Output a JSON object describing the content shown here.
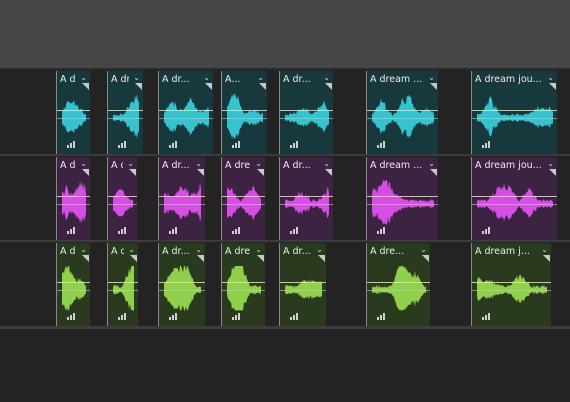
{
  "colors": {
    "topbar": "#464646",
    "track_bg": "#232323",
    "cyan_clip_bg": "#17393e",
    "cyan_wave": "#35c4cf",
    "purple_clip_bg": "#3c2342",
    "purple_wave": "#d64fe4",
    "green_clip_bg": "#2a3a1f",
    "green_wave": "#8fd14a"
  },
  "tracks": [
    {
      "name": "track-cyan",
      "clips": [
        {
          "title": "A dr..."
        },
        {
          "title": "A dr..."
        },
        {
          "title": "A dr..."
        },
        {
          "title": "A..."
        },
        {
          "title": "A dr..."
        },
        {
          "title": "A dream ..."
        },
        {
          "title": "A dream jou..."
        }
      ]
    },
    {
      "name": "track-purple",
      "clips": [
        {
          "title": "A dr..."
        },
        {
          "title": "A d..."
        },
        {
          "title": "A dr..."
        },
        {
          "title": "A dre..."
        },
        {
          "title": "A dr..."
        },
        {
          "title": "A dream ..."
        },
        {
          "title": "A dream jou..."
        }
      ]
    },
    {
      "name": "track-green",
      "clips": [
        {
          "title": "A dr..."
        },
        {
          "title": "A d..."
        },
        {
          "title": "A dr..."
        },
        {
          "title": "A dre..."
        },
        {
          "title": "A dr..."
        },
        {
          "title": "A dre..."
        },
        {
          "title": "A dream j..."
        }
      ]
    }
  ]
}
